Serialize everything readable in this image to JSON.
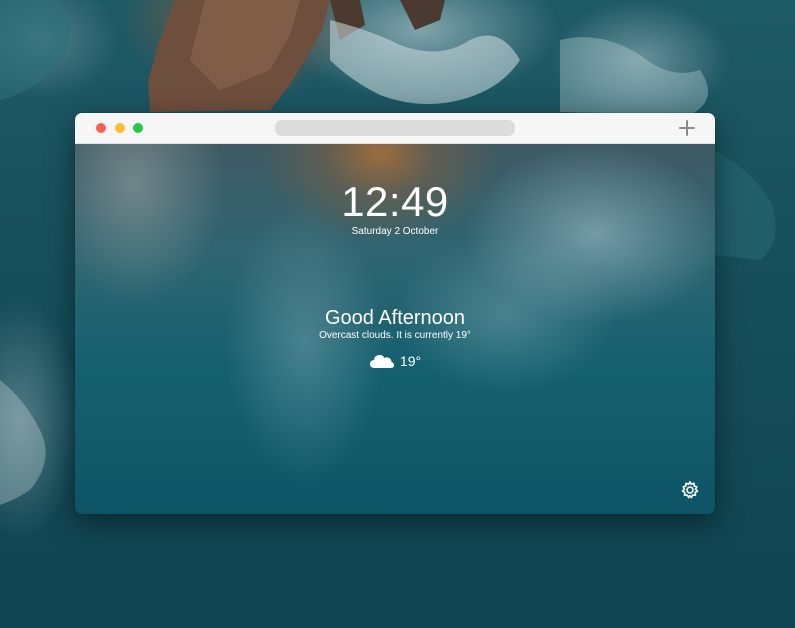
{
  "window": {
    "traffic_lights": {
      "close": "#fe5f57",
      "minimize": "#febc2e",
      "maximize": "#28c840"
    },
    "new_tab_icon": "plus-icon"
  },
  "newtab_page": {
    "time": "12:49",
    "date": "Saturday 2 October",
    "greeting": "Good Afternoon",
    "weather_summary": "Overcast clouds. It is currently 19°",
    "weather_icon": "cloud-icon",
    "temperature": "19°",
    "settings_icon": "gear-icon"
  }
}
